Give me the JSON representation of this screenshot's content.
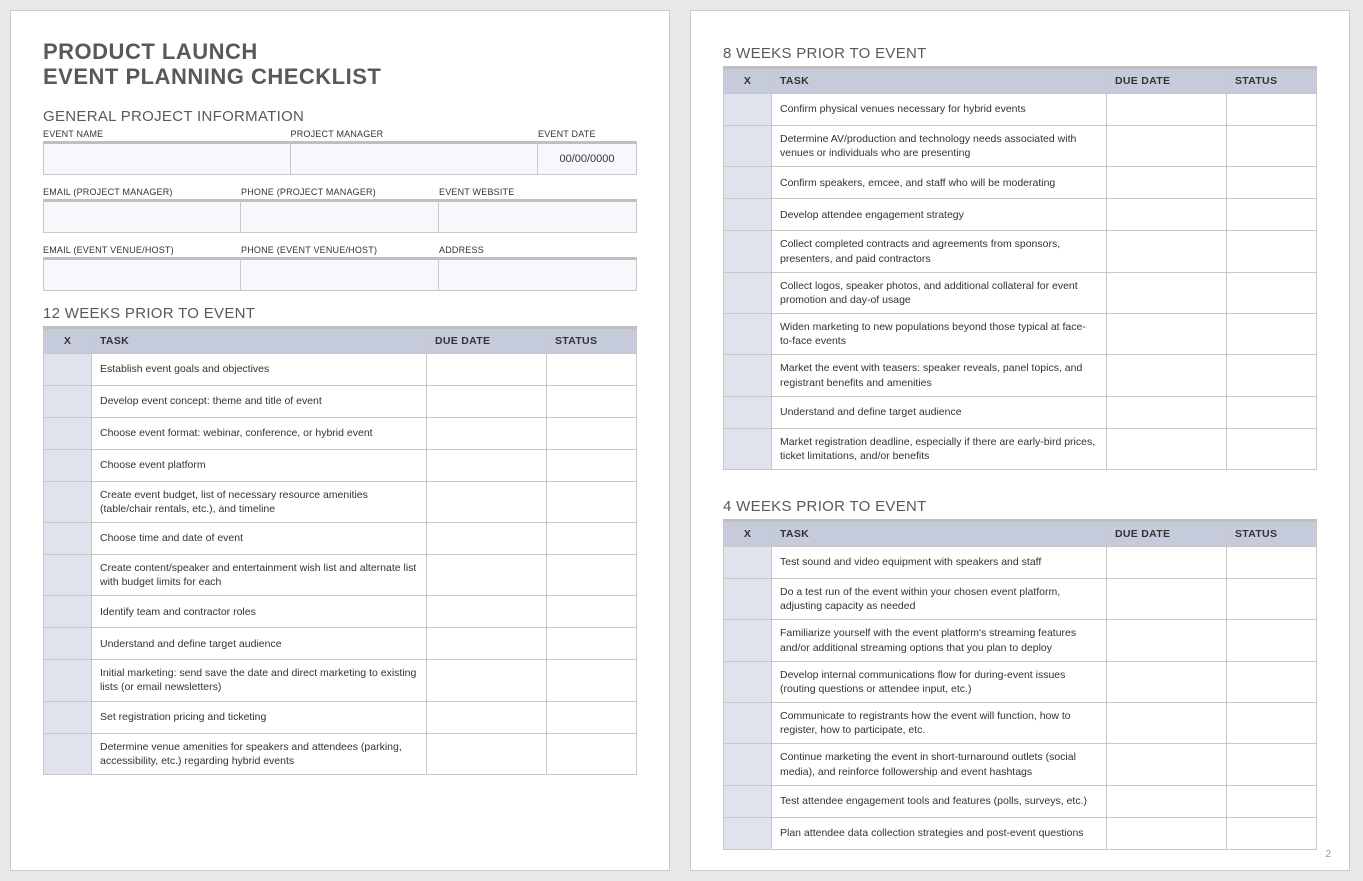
{
  "title_line1": "PRODUCT LAUNCH",
  "title_line2": "EVENT PLANNING CHECKLIST",
  "general_heading": "GENERAL PROJECT INFORMATION",
  "labels": {
    "event_name": "EVENT NAME",
    "project_manager": "PROJECT MANAGER",
    "event_date": "EVENT DATE",
    "email_pm": "EMAIL (PROJECT MANAGER)",
    "phone_pm": "PHONE (PROJECT MANAGER)",
    "event_website": "EVENT WEBSITE",
    "email_venue": "EMAIL (EVENT VENUE/HOST)",
    "phone_venue": "PHONE (EVENT VENUE/HOST)",
    "address": "ADDRESS"
  },
  "values": {
    "event_name": "",
    "project_manager": "",
    "event_date": "00/00/0000",
    "email_pm": "",
    "phone_pm": "",
    "event_website": "",
    "email_venue": "",
    "phone_venue": "",
    "address": ""
  },
  "table_headers": {
    "x": "X",
    "task": "TASK",
    "due_date": "DUE DATE",
    "status": "STATUS"
  },
  "sections": [
    {
      "heading": "12 WEEKS PRIOR TO EVENT",
      "tasks": [
        "Establish event goals and objectives",
        "Develop event concept: theme and title of event",
        "Choose event format: webinar, conference, or hybrid event",
        "Choose event platform",
        "Create event budget, list of necessary resource amenities (table/chair rentals, etc.), and timeline",
        "Choose time and date of event",
        "Create content/speaker and entertainment wish list and alternate list with budget limits for each",
        "Identify team and contractor roles",
        "Understand and define target audience",
        "Initial marketing: send save the date and direct marketing to existing lists (or email newsletters)",
        "Set registration pricing and ticketing",
        "Determine venue amenities for speakers and attendees (parking, accessibility, etc.) regarding hybrid events"
      ]
    },
    {
      "heading": "8 WEEKS PRIOR TO EVENT",
      "tasks": [
        "Confirm physical venues necessary for hybrid events",
        "Determine AV/production and technology needs associated with venues or individuals who are presenting",
        "Confirm speakers, emcee, and staff who will be moderating",
        "Develop attendee engagement strategy",
        "Collect completed contracts and agreements from sponsors, presenters, and paid contractors",
        "Collect logos, speaker photos, and additional collateral for event promotion and day-of usage",
        "Widen marketing to new populations beyond those typical at face-to-face events",
        "Market the event with teasers: speaker reveals, panel topics, and registrant benefits and amenities",
        "Understand and define target audience",
        "Market registration deadline, especially if there are early-bird prices, ticket limitations, and/or benefits"
      ]
    },
    {
      "heading": "4 WEEKS PRIOR TO EVENT",
      "tasks": [
        "Test sound and video equipment with speakers and staff",
        "Do a test run of the event within your chosen event platform, adjusting capacity as needed",
        "Familiarize yourself with the event platform's streaming features and/or additional streaming options that you plan to deploy",
        "Develop internal communications flow for during-event issues (routing questions or attendee input, etc.)",
        "Communicate to registrants how the event will function, how to register, how to participate, etc.",
        "Continue marketing the event in short-turnaround outlets (social media), and reinforce followership and event hashtags",
        "Test attendee engagement tools and features (polls, surveys, etc.)",
        "Plan attendee data collection strategies and post-event questions"
      ]
    }
  ],
  "page_number": "2"
}
